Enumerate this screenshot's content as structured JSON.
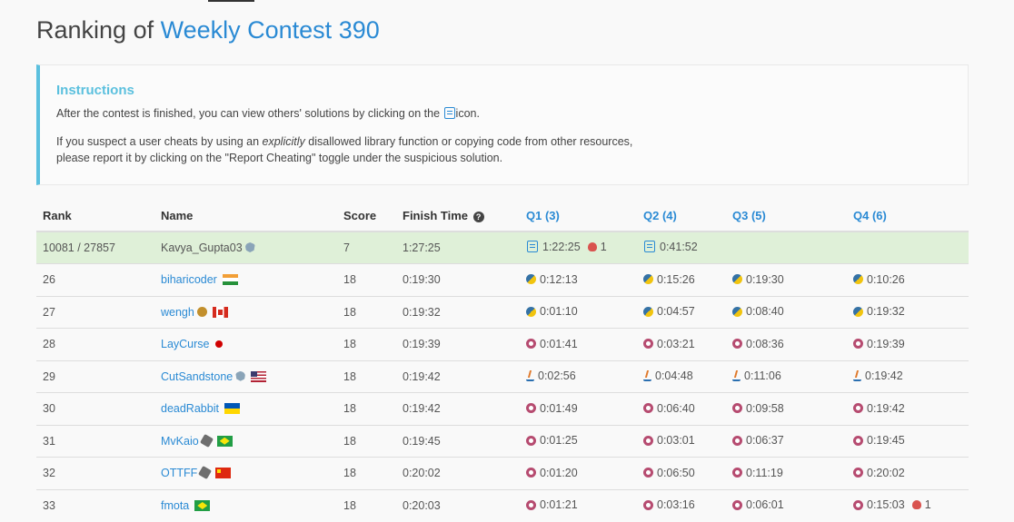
{
  "title": {
    "prefix": "Ranking of",
    "contest": "Weekly Contest 390"
  },
  "instructions": {
    "heading": "Instructions",
    "line1_before": "After the contest is finished, you can view others' solutions by clicking on the",
    "line1_after": "icon.",
    "line2_before": "If you suspect a user cheats by using an",
    "line2_em": "explicitly",
    "line2_after": "disallowed library function or copying code from other resources,",
    "line3": "please report it by clicking on the \"Report Cheating\" toggle under the suspicious solution."
  },
  "table": {
    "headers": {
      "rank": "Rank",
      "name": "Name",
      "score": "Score",
      "finish": "Finish Time",
      "q1": "Q1 (3)",
      "q2": "Q2 (4)",
      "q3": "Q3 (5)",
      "q4": "Q4 (6)"
    },
    "me": {
      "rank": "10081 / 27857",
      "name": "Kavya_Gupta03",
      "score": "7",
      "finish": "1:27:25",
      "q1": "1:22:25",
      "q1_bugs": "1",
      "q2": "0:41:52"
    },
    "rows": [
      {
        "rank": "26",
        "name": "biharicoder",
        "score": "18",
        "finish": "0:19:30",
        "q1": "0:12:13",
        "q2": "0:15:26",
        "q3": "0:19:30",
        "q4": "0:10:26",
        "lang": "py"
      },
      {
        "rank": "27",
        "name": "wengh",
        "score": "18",
        "finish": "0:19:32",
        "q1": "0:01:10",
        "q2": "0:04:57",
        "q3": "0:08:40",
        "q4": "0:19:32",
        "lang": "py"
      },
      {
        "rank": "28",
        "name": "LayCurse",
        "score": "18",
        "finish": "0:19:39",
        "q1": "0:01:41",
        "q2": "0:03:21",
        "q3": "0:08:36",
        "q4": "0:19:39",
        "lang": "cpp"
      },
      {
        "rank": "29",
        "name": "CutSandstone",
        "score": "18",
        "finish": "0:19:42",
        "q1": "0:02:56",
        "q2": "0:04:48",
        "q3": "0:11:06",
        "q4": "0:19:42",
        "lang": "java"
      },
      {
        "rank": "30",
        "name": "deadRabbit",
        "score": "18",
        "finish": "0:19:42",
        "q1": "0:01:49",
        "q2": "0:06:40",
        "q3": "0:09:58",
        "q4": "0:19:42",
        "lang": "cpp"
      },
      {
        "rank": "31",
        "name": "MvKaio",
        "score": "18",
        "finish": "0:19:45",
        "q1": "0:01:25",
        "q2": "0:03:01",
        "q3": "0:06:37",
        "q4": "0:19:45",
        "lang": "cpp"
      },
      {
        "rank": "32",
        "name": "OTTFF",
        "score": "18",
        "finish": "0:20:02",
        "q1": "0:01:20",
        "q2": "0:06:50",
        "q3": "0:11:19",
        "q4": "0:20:02",
        "lang": "cpp"
      },
      {
        "rank": "33",
        "name": "fmota",
        "score": "18",
        "finish": "0:20:03",
        "q1": "0:01:21",
        "q2": "0:03:16",
        "q3": "0:06:01",
        "q4": "0:15:03",
        "q4_bugs": "1",
        "lang": "cpp"
      }
    ]
  }
}
